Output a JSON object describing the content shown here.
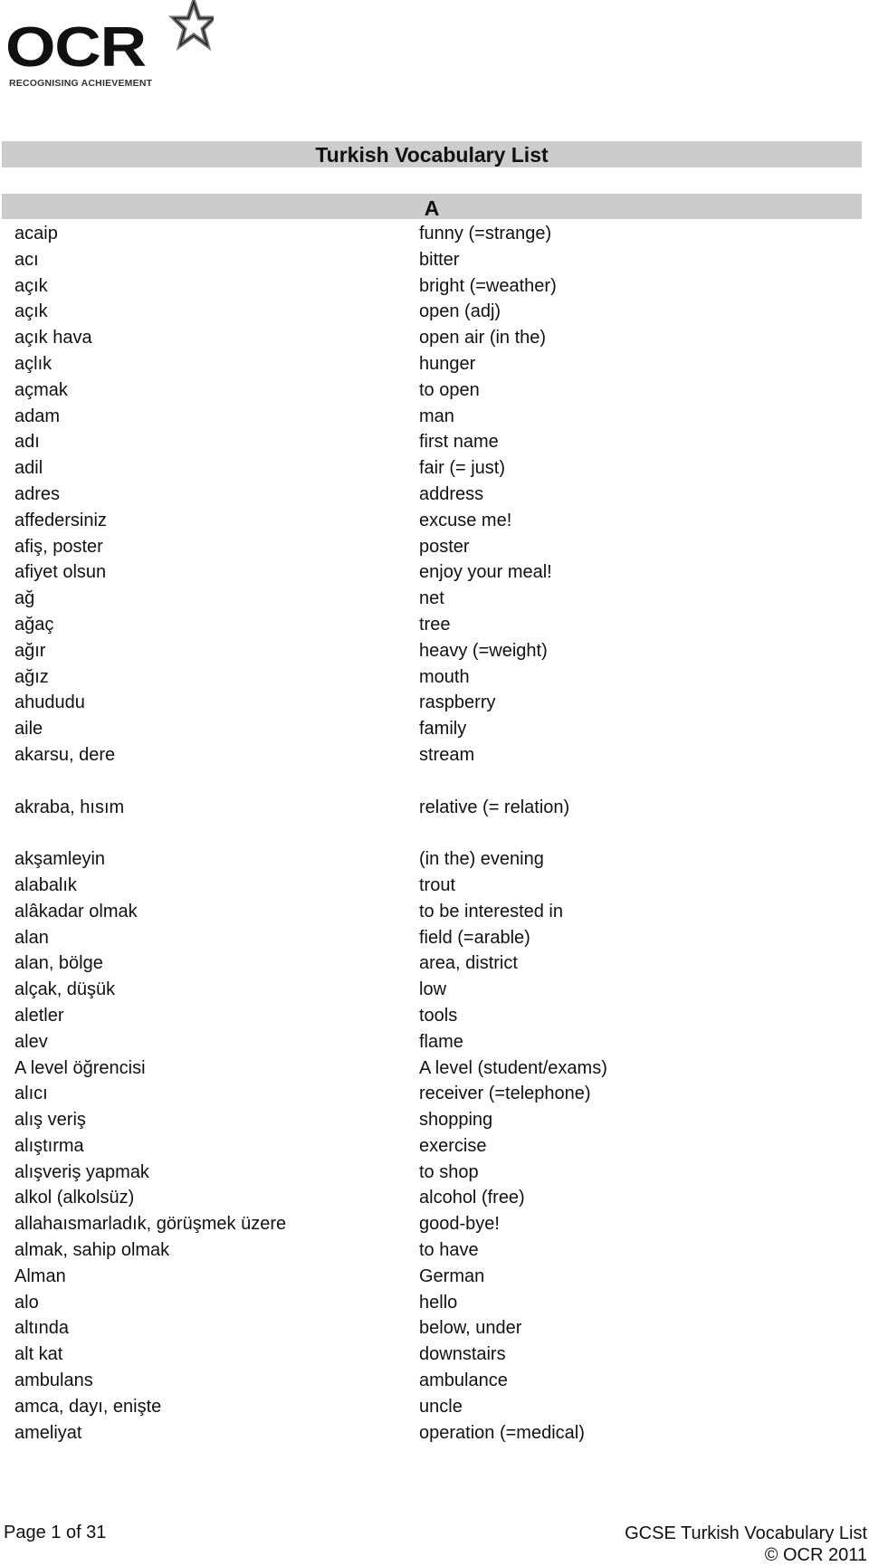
{
  "logo": {
    "text": "OCR",
    "tagline": "RECOGNISING ACHIEVEMENT"
  },
  "title": "Turkish Vocabulary List",
  "section_letter": "A",
  "entries": [
    {
      "turkish": "acaip",
      "english": "funny (=strange)"
    },
    {
      "turkish": "acı",
      "english": "bitter"
    },
    {
      "turkish": "açık",
      "english": "bright (=weather)"
    },
    {
      "turkish": "açık",
      "english": "open (adj)"
    },
    {
      "turkish": "açık hava",
      "english": "open air (in the)"
    },
    {
      "turkish": "açlık",
      "english": "hunger"
    },
    {
      "turkish": "açmak",
      "english": "to open"
    },
    {
      "turkish": "adam",
      "english": "man"
    },
    {
      "turkish": "adı",
      "english": "first name"
    },
    {
      "turkish": "adil",
      "english": "fair (= just)"
    },
    {
      "turkish": "adres",
      "english": "address"
    },
    {
      "turkish": "affedersiniz",
      "english": "excuse me!"
    },
    {
      "turkish": "afiş, poster",
      "english": "poster"
    },
    {
      "turkish": "afiyet olsun",
      "english": "enjoy your meal!"
    },
    {
      "turkish": "ağ",
      "english": "net"
    },
    {
      "turkish": "ağaç",
      "english": "tree"
    },
    {
      "turkish": "ağır",
      "english": "heavy (=weight)"
    },
    {
      "turkish": "ağız",
      "english": "mouth"
    },
    {
      "turkish": "ahududu",
      "english": "raspberry"
    },
    {
      "turkish": "aile",
      "english": "family"
    },
    {
      "turkish": "akarsu, dere",
      "english": "stream"
    },
    {
      "turkish": "akraba, hısım",
      "english": "relative (= relation)"
    },
    {
      "turkish": "akşamleyin",
      "english": "(in the) evening"
    },
    {
      "turkish": "alabalık",
      "english": "trout"
    },
    {
      "turkish": "alâkadar olmak",
      "english": "to be interested in"
    },
    {
      "turkish": "alan",
      "english": "field (=arable)"
    },
    {
      "turkish": "alan, bölge",
      "english": "area, district"
    },
    {
      "turkish": "alçak, düşük",
      "english": "low"
    },
    {
      "turkish": "aletler",
      "english": "tools"
    },
    {
      "turkish": "alev",
      "english": "flame"
    },
    {
      "turkish": "A level öğrencisi",
      "english": "A level (student/exams)"
    },
    {
      "turkish": "alıcı",
      "english": "receiver (=telephone)"
    },
    {
      "turkish": "alış veriş",
      "english": "shopping"
    },
    {
      "turkish": "alıştırma",
      "english": "exercise"
    },
    {
      "turkish": "alışveriş yapmak",
      "english": "to shop"
    },
    {
      "turkish": "alkol (alkolsüz)",
      "english": "alcohol (free)"
    },
    {
      "turkish": "allahaısmarladık, görüşmek üzere",
      "english": "good-bye!"
    },
    {
      "turkish": "almak, sahip olmak",
      "english": "to have"
    },
    {
      "turkish": "Alman",
      "english": "German"
    },
    {
      "turkish": "alo",
      "english": "hello"
    },
    {
      "turkish": "altında",
      "english": "below, under"
    },
    {
      "turkish": "alt kat",
      "english": "downstairs"
    },
    {
      "turkish": "ambulans",
      "english": "ambulance"
    },
    {
      "turkish": "amca, dayı, enişte",
      "english": "uncle"
    },
    {
      "turkish": "ameliyat",
      "english": "operation (=medical)"
    }
  ],
  "footer": {
    "page": "Page 1 of 31",
    "doc_title": "GCSE Turkish Vocabulary List",
    "copyright": "© OCR 2011"
  }
}
